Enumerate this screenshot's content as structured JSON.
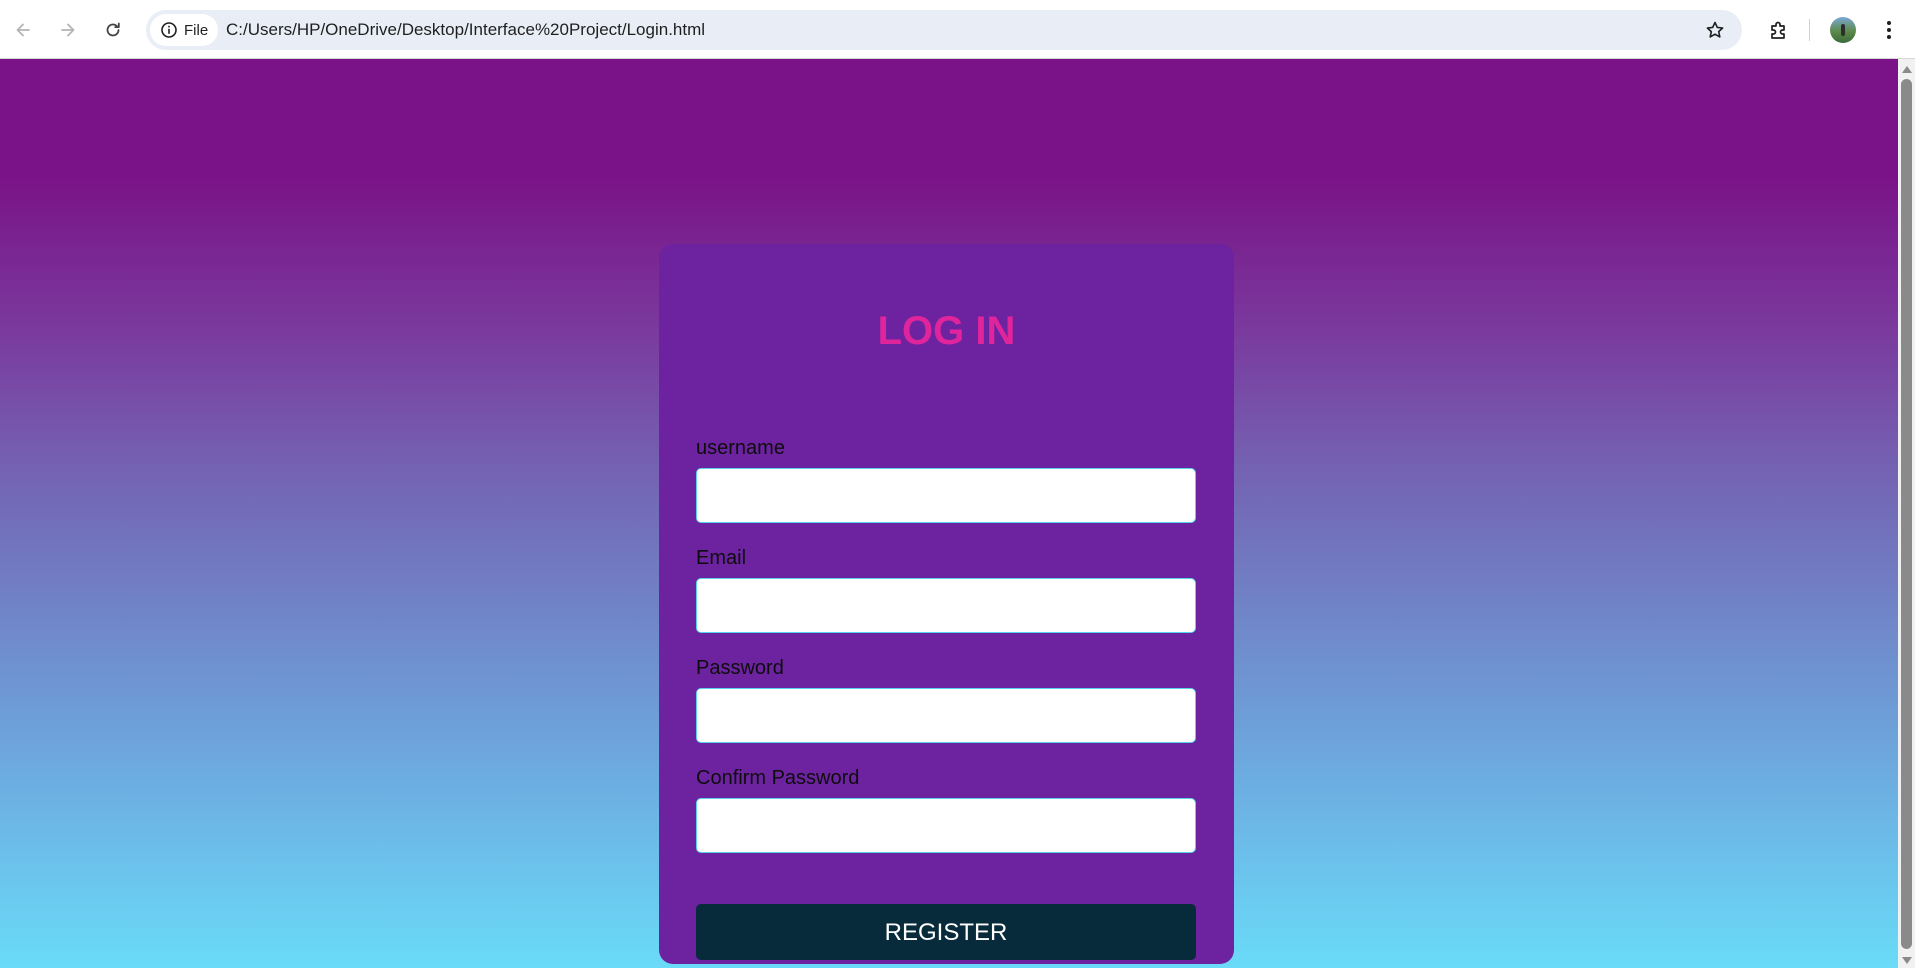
{
  "browser": {
    "site_chip_label": "File",
    "url": "C:/Users/HP/OneDrive/Desktop/Interface%20Project/Login.html",
    "icons": {
      "back": "arrow-left-icon",
      "forward": "arrow-right-icon",
      "reload": "reload-icon",
      "site_info": "info-icon",
      "bookmark": "star-icon",
      "extensions": "puzzle-icon",
      "menu": "kebab-menu-icon"
    }
  },
  "login": {
    "title": "LOG IN",
    "fields": [
      {
        "label": "username",
        "value": ""
      },
      {
        "label": "Email",
        "value": ""
      },
      {
        "label": "Password",
        "value": ""
      },
      {
        "label": "Confirm Password",
        "value": ""
      }
    ],
    "register_label": "REGISTER"
  },
  "colors": {
    "card_background": "#6d22a0",
    "title": "#e0259c",
    "button_background": "#072b3a",
    "input_border": "#57d3ea",
    "gradient_top": "#7a1387",
    "gradient_bottom": "#6adbf8"
  }
}
